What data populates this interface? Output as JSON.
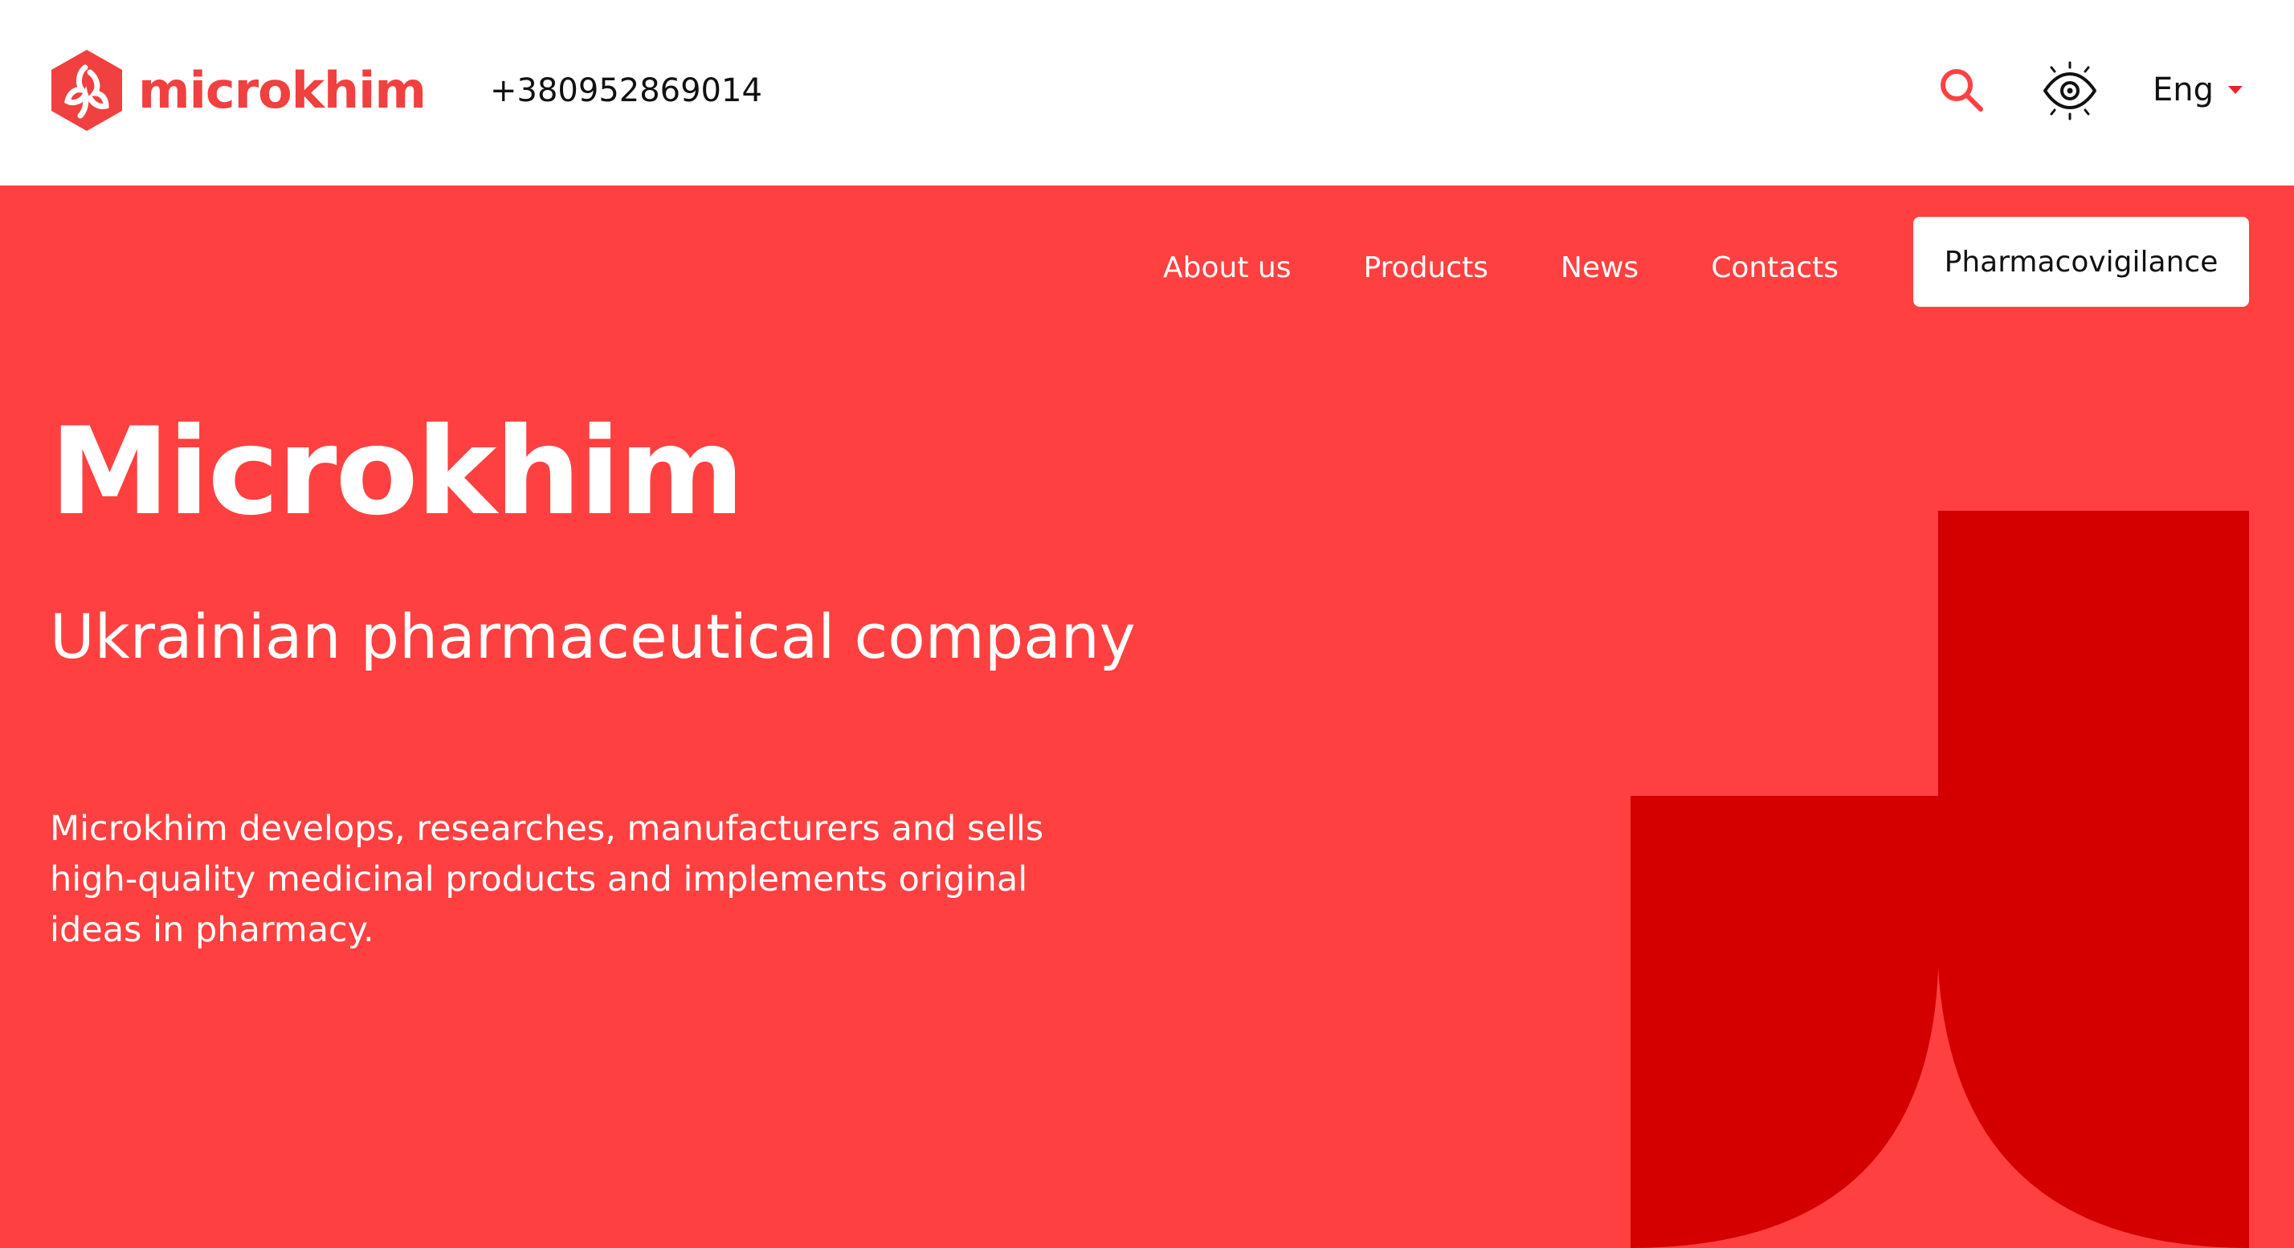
{
  "header": {
    "logo_text": "microkhim",
    "phone": "+380952869014",
    "language": "Eng",
    "icons": {
      "search": "search-icon",
      "accessibility": "eye-icon",
      "language_caret": "caret-down-icon"
    }
  },
  "nav": {
    "items": [
      {
        "label": "About us"
      },
      {
        "label": "Products"
      },
      {
        "label": "News"
      },
      {
        "label": "Contacts"
      }
    ],
    "cta_label": "Pharmacovigilance"
  },
  "hero": {
    "title": "Microkhim",
    "subtitle": "Ukrainian pharmaceutical company",
    "description": "Microkhim develops, researches, manufacturers and sells high-quality medicinal products and implements original ideas in pharmacy."
  },
  "colors": {
    "brand_red": "#ff4040",
    "logo_red": "#f04040",
    "dark_red": "#d40000",
    "text_dark": "#111111",
    "white": "#ffffff"
  }
}
